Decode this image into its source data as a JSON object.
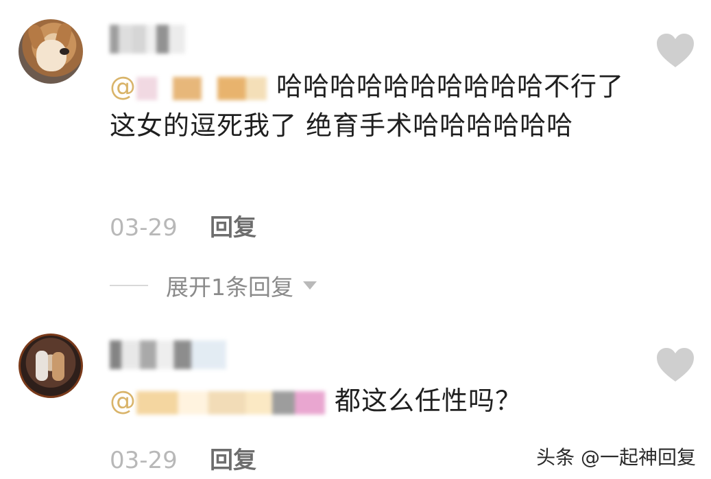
{
  "comments": [
    {
      "mention_prefix": "@",
      "text": "哈哈哈哈哈哈哈哈哈哈不行了这女的逗死我了 绝育手术哈哈哈哈哈哈",
      "date": "03-29",
      "reply_label": "回复",
      "expand_label": "展开1条回复"
    },
    {
      "mention_prefix": "@",
      "text": "都这么任性吗？",
      "date": "03-29",
      "reply_label": "回复"
    }
  ],
  "icons": [
    "heart-icon",
    "chevron-down-icon"
  ],
  "colors": {
    "mention": "#d9b46a",
    "heart": "#cfcfcf"
  },
  "watermark": "头条 @一起神回复"
}
